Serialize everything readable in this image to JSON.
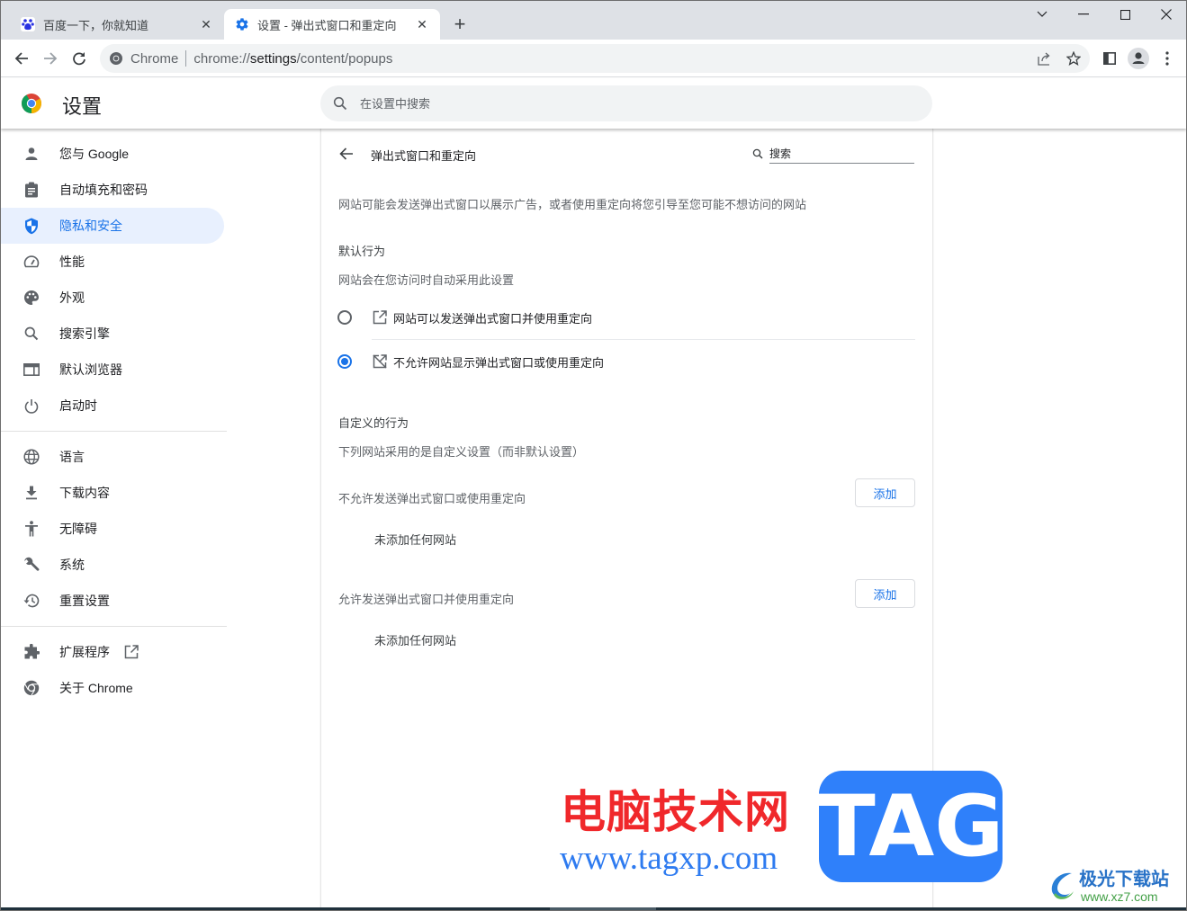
{
  "browser": {
    "tabs": [
      {
        "title": "百度一下，你就知道",
        "icon": "baidu-paw-icon",
        "active": false
      },
      {
        "title": "设置 - 弹出式窗口和重定向",
        "icon": "gear-icon",
        "active": true
      }
    ],
    "new_tab_label": "+",
    "omnibox": {
      "site_chip": "Chrome",
      "url_prefix": "chrome://",
      "url_host": "settings",
      "url_path": "/content/popups"
    }
  },
  "settings": {
    "title": "设置",
    "search_placeholder": "在设置中搜索"
  },
  "sidebar": {
    "items": [
      {
        "label": "您与 Google",
        "icon": "person-icon"
      },
      {
        "label": "自动填充和密码",
        "icon": "clipboard-icon"
      },
      {
        "label": "隐私和安全",
        "icon": "shield-icon",
        "active": true
      },
      {
        "label": "性能",
        "icon": "speedometer-icon"
      },
      {
        "label": "外观",
        "icon": "palette-icon"
      },
      {
        "label": "搜索引擎",
        "icon": "search-icon"
      },
      {
        "label": "默认浏览器",
        "icon": "browser-window-icon"
      },
      {
        "label": "启动时",
        "icon": "power-icon"
      },
      {
        "label": "语言",
        "icon": "globe-icon"
      },
      {
        "label": "下载内容",
        "icon": "download-icon"
      },
      {
        "label": "无障碍",
        "icon": "accessibility-icon"
      },
      {
        "label": "系统",
        "icon": "wrench-icon"
      },
      {
        "label": "重置设置",
        "icon": "restore-icon"
      },
      {
        "label": "扩展程序",
        "icon": "puzzle-icon",
        "external": true
      },
      {
        "label": "关于 Chrome",
        "icon": "chrome-icon"
      }
    ]
  },
  "page": {
    "title": "弹出式窗口和重定向",
    "search_placeholder": "搜索",
    "description": "网站可能会发送弹出式窗口以展示广告，或者使用重定向将您引导至您可能不想访问的网站",
    "default_behavior": {
      "heading": "默认行为",
      "subheading": "网站会在您访问时自动采用此设置",
      "options": [
        {
          "label": "网站可以发送弹出式窗口并使用重定向",
          "icon": "open-in-new-icon",
          "checked": false
        },
        {
          "label": "不允许网站显示弹出式窗口或使用重定向",
          "icon": "popup-blocked-icon",
          "checked": true
        }
      ]
    },
    "custom_behavior": {
      "heading": "自定义的行为",
      "subheading": "下列网站采用的是自定义设置（而非默认设置）",
      "lists": [
        {
          "title": "不允许发送弹出式窗口或使用重定向",
          "add_label": "添加",
          "empty_text": "未添加任何网站"
        },
        {
          "title": "允许发送弹出式窗口并使用重定向",
          "add_label": "添加",
          "empty_text": "未添加任何网站"
        }
      ]
    }
  },
  "watermark": {
    "cn_text": "电脑技术网",
    "url": "www.tagxp.com",
    "badge": "TAG",
    "xz_name": "极光下载站",
    "xz_url": "www.xz7.com"
  },
  "colors": {
    "accent": "#1a73e8",
    "active_nav_bg": "#e8f0fe",
    "tabstrip_bg": "#dee1e6",
    "omnibox_bg": "#f1f3f4"
  }
}
